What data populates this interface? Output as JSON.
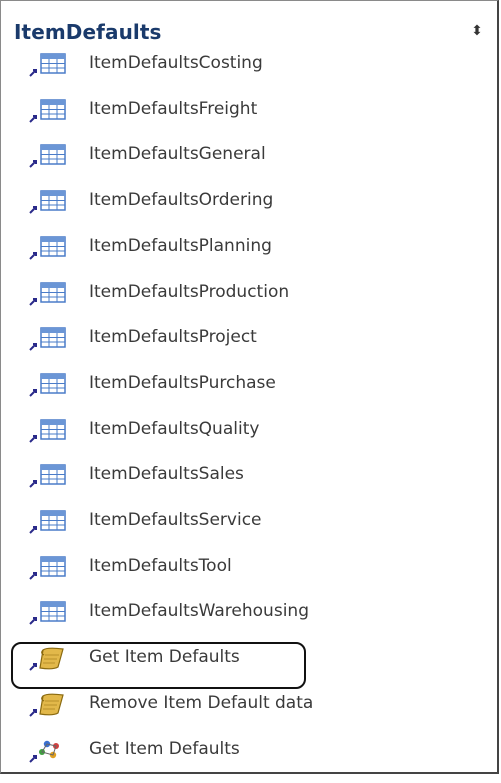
{
  "group": {
    "title": "ItemDefaults",
    "collapse_glyph": "⬍"
  },
  "items": [
    {
      "label": "ItemDefaultsCosting",
      "icon": "linked-table-icon"
    },
    {
      "label": "ItemDefaultsFreight",
      "icon": "linked-table-icon"
    },
    {
      "label": "ItemDefaultsGeneral",
      "icon": "linked-table-icon"
    },
    {
      "label": "ItemDefaultsOrdering",
      "icon": "linked-table-icon"
    },
    {
      "label": "ItemDefaultsPlanning",
      "icon": "linked-table-icon"
    },
    {
      "label": "ItemDefaultsProduction",
      "icon": "linked-table-icon"
    },
    {
      "label": "ItemDefaultsProject",
      "icon": "linked-table-icon"
    },
    {
      "label": "ItemDefaultsPurchase",
      "icon": "linked-table-icon"
    },
    {
      "label": "ItemDefaultsQuality",
      "icon": "linked-table-icon"
    },
    {
      "label": "ItemDefaultsSales",
      "icon": "linked-table-icon"
    },
    {
      "label": "ItemDefaultsService",
      "icon": "linked-table-icon"
    },
    {
      "label": "ItemDefaultsTool",
      "icon": "linked-table-icon"
    },
    {
      "label": "ItemDefaultsWarehousing",
      "icon": "linked-table-icon"
    },
    {
      "label": "Get Item Defaults",
      "icon": "macro-scroll-icon"
    },
    {
      "label": "Remove Item Default data",
      "icon": "macro-scroll-icon"
    },
    {
      "label": "Get Item Defaults",
      "icon": "module-people-icon"
    }
  ],
  "colors": {
    "title": "#1a3a6b",
    "table_icon_blue": "#4a7cc9",
    "link_arrow": "#2a2a8a",
    "highlight_border": "#111111"
  }
}
